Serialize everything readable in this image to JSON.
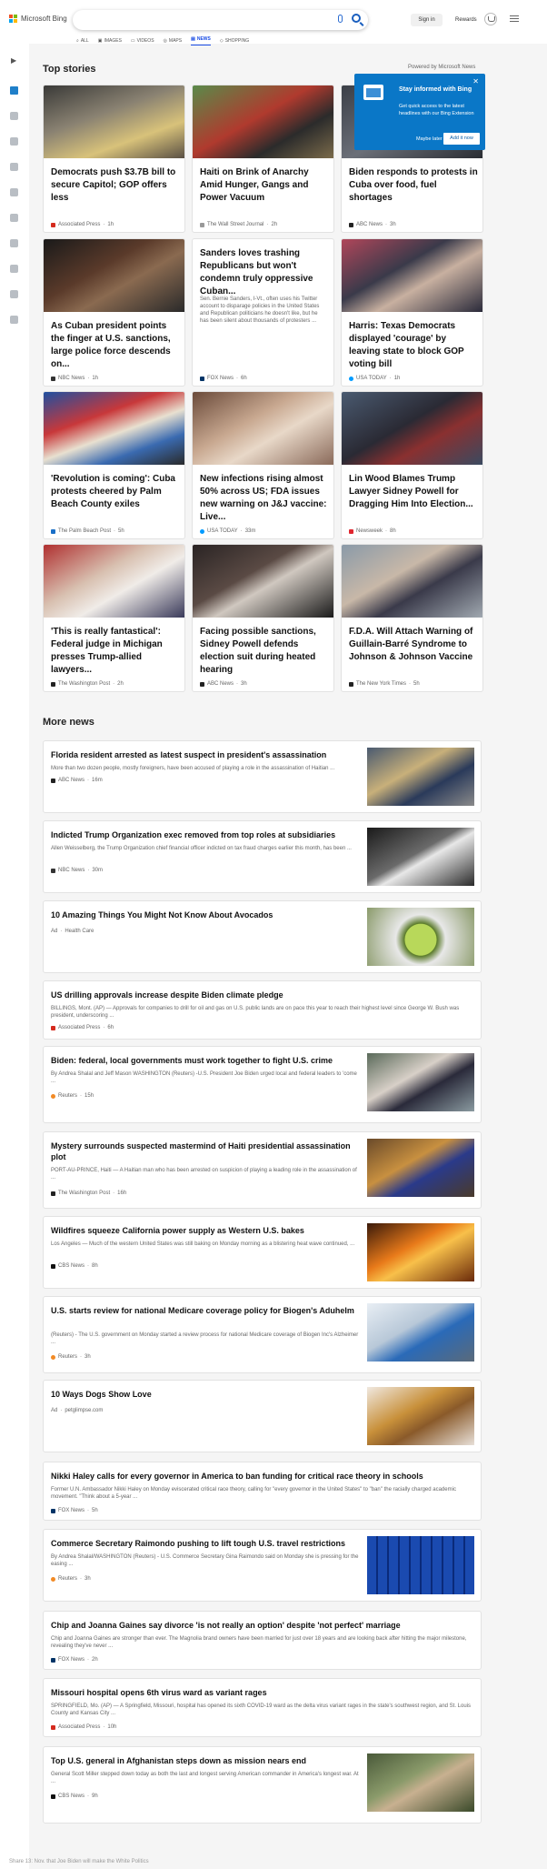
{
  "header": {
    "brand": "Microsoft Bing",
    "sign_in": "Sign in",
    "rewards": "Rewards",
    "scopes": [
      {
        "label": "ALL"
      },
      {
        "label": "IMAGES"
      },
      {
        "label": "VIDEOS"
      },
      {
        "label": "MAPS"
      },
      {
        "label": "NEWS"
      },
      {
        "label": "SHOPPING"
      }
    ],
    "active_scope": "NEWS"
  },
  "top_stories": {
    "title": "Top stories",
    "powered_by": "Powered by Microsoft News",
    "cards": [
      {
        "title": "Democrats push $3.7B bill to secure Capitol; GOP offers less",
        "source": "Associated Press",
        "age": "1h"
      },
      {
        "title": "Haiti on Brink of Anarchy Amid Hunger, Gangs and Power Vacuum",
        "source": "The Wall Street Journal",
        "age": "2h"
      },
      {
        "title": "Biden responds to protests in Cuba over food, fuel shortages",
        "source": "ABC News",
        "age": "3h"
      },
      {
        "title": "As Cuban president points the finger at U.S. sanctions, large police force descends on...",
        "source": "NBC News",
        "age": "1h"
      },
      {
        "title": "Sanders loves trashing Republicans but won't condemn truly oppressive Cuban...",
        "snippet": "Sen. Bernie Sanders, I-Vt., often uses his Twitter account to disparage policies in the United States and Republican politicians he doesn't like, but he has been silent about thousands of protesters ...",
        "source": "FOX News",
        "age": "6h"
      },
      {
        "title": "Harris: Texas Democrats displayed 'courage' by leaving state to block GOP voting bill",
        "source": "USA TODAY",
        "age": "1h"
      },
      {
        "title": "'Revolution is coming': Cuba protests cheered by Palm Beach County exiles",
        "source": "The Palm Beach Post",
        "age": "5h"
      },
      {
        "title": "New infections rising almost 50% across US; FDA issues new warning on J&J vaccine: Live...",
        "source": "USA TODAY",
        "age": "33m"
      },
      {
        "title": "Lin Wood Blames Trump Lawyer Sidney Powell for Dragging Him Into Election...",
        "source": "Newsweek",
        "age": "8h"
      },
      {
        "title": "'This is really fantastical': Federal judge in Michigan presses Trump-allied lawyers...",
        "source": "The Washington Post",
        "age": "2h"
      },
      {
        "title": "Facing possible sanctions, Sidney Powell defends election suit during heated hearing",
        "source": "ABC News",
        "age": "3h"
      },
      {
        "title": "F.D.A. Will Attach Warning of Guillain-Barré Syndrome to Johnson & Johnson Vaccine",
        "source": "The New York Times",
        "age": "5h"
      }
    ]
  },
  "popup": {
    "title": "Stay informed with Bing",
    "description": "Get quick access to the latest headlines with our Bing Extension",
    "maybe_later": "Maybe later",
    "add_button": "Add it now",
    "close": "✕"
  },
  "more_news": {
    "title": "More news",
    "items": [
      {
        "title": "Florida resident arrested as latest suspect in president's assassination",
        "snippet": "More than two dozen people, mostly foreigners, have been accused of playing a role in the assassination of Haitian ...",
        "source": "ABC News",
        "age": "16m"
      },
      {
        "title": "Indicted Trump Organization exec removed from top roles at subsidiaries",
        "snippet": "Allen Weisselberg, the Trump Organization chief financial officer indicted on tax fraud charges earlier this month, has been ...",
        "source": "NBC News",
        "age": "30m"
      },
      {
        "title": "10 Amazing Things You Might Not Know About Avocados",
        "ad": "Ad",
        "source": "Health Care"
      },
      {
        "title": "US drilling approvals increase despite Biden climate pledge",
        "snippet": "BILLINGS, Mont. (AP) — Approvals for companies to drill for oil and gas on U.S. public lands are on pace this year to reach their highest level since George W. Bush was president, underscoring ...",
        "source": "Associated Press",
        "age": "6h"
      },
      {
        "title": "Biden: federal, local governments must work together to fight U.S. crime",
        "snippet": "By Andrea Shalal and Jeff Mason WASHINGTON (Reuters) -U.S. President Joe Biden urged local and federal leaders to 'come ...",
        "source": "Reuters",
        "age": "15h"
      },
      {
        "title": "Mystery surrounds suspected mastermind of Haiti presidential assassination plot",
        "snippet": "PORT-AU-PRINCE, Haiti — A Haitian man who has been arrested on suspicion of playing a leading role in the assassination of ...",
        "source": "The Washington Post",
        "age": "16h"
      },
      {
        "title": "Wildfires squeeze California power supply as Western U.S. bakes",
        "snippet": "Los Angeles — Much of the western United States was still baking on Monday morning as a blistering heat wave continued, ...",
        "source": "CBS News",
        "age": "8h"
      },
      {
        "title": "U.S. starts review for national Medicare coverage policy for Biogen's Aduhelm",
        "snippet": "(Reuters) - The U.S. government on Monday started a review process for national Medicare coverage of Biogen Inc's Alzheimer ...",
        "source": "Reuters",
        "age": "3h"
      },
      {
        "title": "10 Ways Dogs Show Love",
        "ad": "Ad",
        "source": "petglimpse.com"
      },
      {
        "title": "Nikki Haley calls for every governor in America to ban funding for critical race theory in schools",
        "snippet": "Former U.N. Ambassador Nikki Haley on Monday eviscerated critical race theory, calling for \"every governor in the United States\" to \"ban\" the racially charged academic movement. \"Think about a 5-year ...",
        "source": "FOX News",
        "age": "5h"
      },
      {
        "title": "Commerce Secretary Raimondo pushing to lift tough U.S. travel restrictions",
        "snippet": "By Andrea Shalal/WASHINGTON (Reuters) - U.S. Commerce Secretary Gina Raimondo said on Monday she is pressing for the easing ...",
        "source": "Reuters",
        "age": "3h"
      },
      {
        "title": "Chip and Joanna Gaines say divorce 'is not really an option' despite 'not perfect' marriage",
        "snippet": "Chip and Joanna Gaines are stronger than ever. The Magnolia brand owners have been married for just over 18 years and are looking back after hitting the major milestone, revealing they've never ...",
        "source": "FOX News",
        "age": "2h"
      },
      {
        "title": "Missouri hospital opens 6th virus ward as variant rages",
        "snippet": "SPRINGFIELD, Mo. (AP) — A Springfield, Missouri, hospital has opened its sixth COVID-19 ward as the delta virus variant rages in the state's southwest region, and St. Louis County and Kansas City ...",
        "source": "Associated Press",
        "age": "10h"
      },
      {
        "title": "Top U.S. general in Afghanistan steps down as mission nears end",
        "snippet": "General Scott Miller stepped down today as both the last and longest serving American commander in America's longest war. At ...",
        "source": "CBS News",
        "age": "9h"
      }
    ]
  },
  "footer": {
    "text": "Share 13: Nov. that Joe Biden will make the White Politics"
  },
  "colors": {
    "accent": "#174ae4",
    "popup_bg": "#0a77c7",
    "page_bg": "#f5f5f5"
  }
}
